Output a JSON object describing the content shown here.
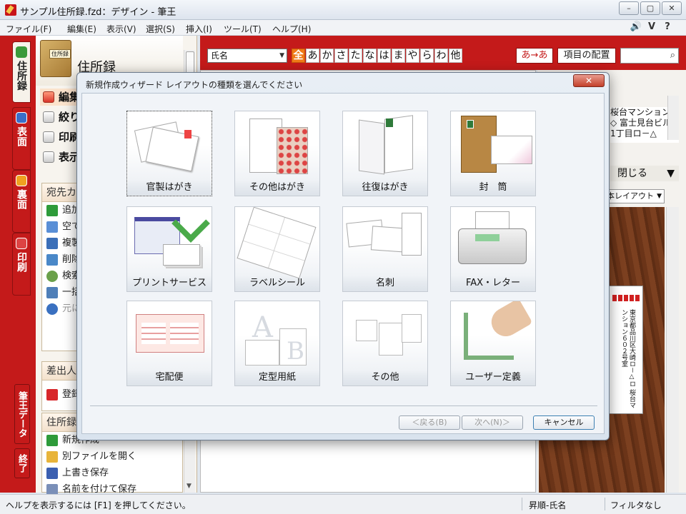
{
  "window": {
    "title": "サンプル住所録.fzd：デザイン - 筆王",
    "controls": [
      "–",
      "▢",
      "✕"
    ]
  },
  "menubar": {
    "items": [
      "ファイル(F)",
      "編集(E)",
      "表示(V)",
      "選択(S)",
      "挿入(I)",
      "ツール(T)",
      "ヘルプ(H)"
    ],
    "right_icons": [
      "speaker-icon",
      "shield-icon",
      "help-icon"
    ],
    "right_glyphs": [
      "🔊",
      "V",
      "?"
    ]
  },
  "left_tabs": [
    {
      "label": "住所録",
      "icon": "address-book-icon",
      "active": true
    },
    {
      "label": "表面",
      "icon": "front-icon",
      "active": false
    },
    {
      "label": "裏面",
      "icon": "back-icon",
      "active": false
    },
    {
      "label": "印刷",
      "icon": "print-icon",
      "active": false
    }
  ],
  "bottom_tabs": {
    "data": "筆王データ",
    "exit": "終了"
  },
  "left_panel": {
    "book_label": "住所録",
    "title": "住所録",
    "items": [
      "編集",
      "絞り",
      "印刷",
      "表示"
    ],
    "box1": {
      "header": "宛先カ",
      "rows": [
        "追加",
        "空て",
        "複製",
        "削除",
        "検索",
        "一括",
        "元に"
      ]
    },
    "box2": {
      "header": "差出人",
      "rows": [
        "登録"
      ]
    },
    "box3": {
      "header": "住所録",
      "rows": [
        "新規作成",
        "別ファイルを開く",
        "上書き保存",
        "名前を付けて保存"
      ]
    }
  },
  "toolbar": {
    "field_select": "氏名",
    "kana": [
      "全",
      "あ",
      "か",
      "さ",
      "た",
      "な",
      "は",
      "ま",
      "や",
      "ら",
      "わ",
      "他"
    ],
    "kana_selected": 0,
    "ime_button": "あ→あ",
    "layout_button": "項目の配置",
    "search_placeholder": ""
  },
  "right_panel": {
    "list": [
      "桜台マンション6",
      "◇ 富士見台ビル",
      "1丁目ロ－△"
    ],
    "close_label": "閉じる",
    "layout_select": "本レイアウト",
    "card_address": "東京都品川区大崎ロ－△ロ 桜台マンション６０２号室"
  },
  "dialog": {
    "title": "新規作成ウィザード レイアウトの種類を選んでください",
    "close_glyph": "✕",
    "tiles": [
      {
        "label": "官製はがき",
        "icon": "official-postcard-icon",
        "selected": true
      },
      {
        "label": "その他はがき",
        "icon": "other-postcard-icon",
        "selected": false
      },
      {
        "label": "往復はがき",
        "icon": "reply-postcard-icon",
        "selected": false
      },
      {
        "label": "封　筒",
        "icon": "envelope-icon",
        "selected": false
      },
      {
        "label": "プリントサービス",
        "icon": "print-service-icon",
        "selected": false
      },
      {
        "label": "ラベルシール",
        "icon": "label-sticker-icon",
        "selected": false
      },
      {
        "label": "名刺",
        "icon": "business-card-icon",
        "selected": false
      },
      {
        "label": "FAX・レター",
        "icon": "fax-icon",
        "selected": false
      },
      {
        "label": "宅配便",
        "icon": "delivery-slip-icon",
        "selected": false
      },
      {
        "label": "定型用紙",
        "icon": "standard-paper-icon",
        "selected": false
      },
      {
        "label": "その他",
        "icon": "other-layout-icon",
        "selected": false
      },
      {
        "label": "ユーザー定義",
        "icon": "user-defined-icon",
        "selected": false
      }
    ],
    "buttons": {
      "back": "＜戻る(B)",
      "next": "次へ(N)＞",
      "cancel": "キャンセル"
    }
  },
  "statusbar": {
    "help": "ヘルプを表示するには [F1] を押してください。",
    "sort": "昇順-氏名",
    "filter": "フィルタなし"
  }
}
